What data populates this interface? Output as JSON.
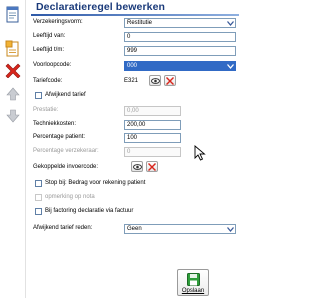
{
  "title": "Declaratieregel bewerken",
  "fields": {
    "verzekeringsvorm": {
      "label": "Verzekeringsvorm:",
      "value": "Restitutie"
    },
    "leeftijd_van": {
      "label": "Leeftijd van:",
      "value": "0"
    },
    "leeftijd_tm": {
      "label": "Leeftijd t/m:",
      "value": "999"
    },
    "voorloopcode": {
      "label": "Voorloopcode:",
      "value": "000"
    },
    "tariefcode": {
      "label": "Tariefcode:",
      "value": "E321"
    },
    "afwijkend_tarief": {
      "label": "Afwijkend tarief"
    },
    "prestatie": {
      "label": "Prestatie:",
      "value": "0,00"
    },
    "techniekkosten": {
      "label": "Techniekkosten:",
      "value": "200,00"
    },
    "percentage_patient": {
      "label": "Percentage patient:",
      "value": "100"
    },
    "percentage_verzekeraar": {
      "label": "Percentage verzekeraar:",
      "value": "0"
    },
    "gekoppelde_invoercode": {
      "label": "Gekoppelde invoercode:"
    },
    "stop_bij": {
      "label": "Stop bij: Bedrag voor rekening patient"
    },
    "opmerking": {
      "label": "opmerking op nota"
    },
    "bij_factoring": {
      "label": "Bij factoring declaratie via factuur"
    },
    "afwijkend_tarief_reden": {
      "label": "Afwijkend tarief reden:",
      "value": "Geen"
    }
  },
  "save_label": "Opslaan",
  "icons": {
    "sidebar": [
      "document-icon",
      "new-document-icon",
      "delete-x-icon",
      "arrow-up-icon",
      "arrow-down-icon"
    ],
    "search": "eye-icon",
    "clear": "red-x-icon",
    "save": "floppy-disk-icon"
  },
  "colors": {
    "title": "#1a3a7a",
    "highlight": "#316ac5",
    "delete": "#d9261c",
    "save": "#2e9e3a"
  }
}
